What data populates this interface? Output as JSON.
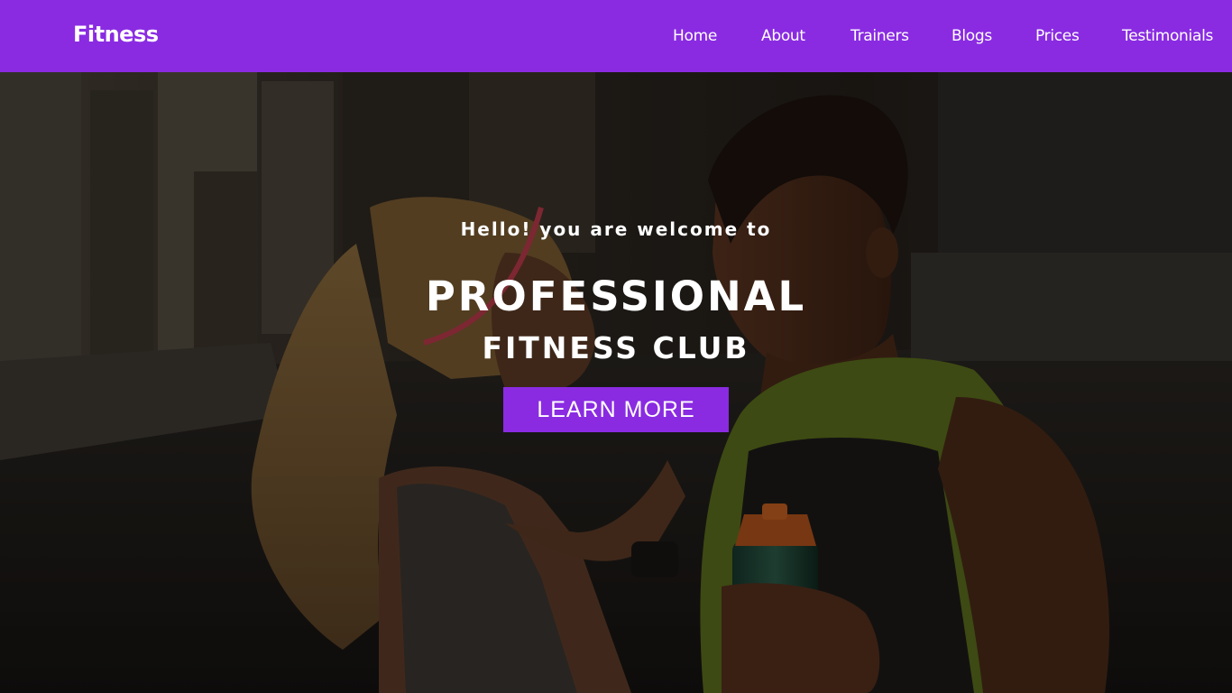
{
  "navbar": {
    "brand": "Fitness",
    "items": [
      {
        "label": "Home"
      },
      {
        "label": "About"
      },
      {
        "label": "Trainers"
      },
      {
        "label": "Blogs"
      },
      {
        "label": "Prices"
      },
      {
        "label": "Testimonials"
      }
    ]
  },
  "hero": {
    "welcome": "Hello! you are welcome to",
    "headline": "PROFESSIONAL",
    "subheadline": "FITNESS CLUB",
    "cta_label": "LEARN MORE"
  },
  "colors": {
    "accent": "#8a2be2",
    "text": "#ffffff"
  }
}
